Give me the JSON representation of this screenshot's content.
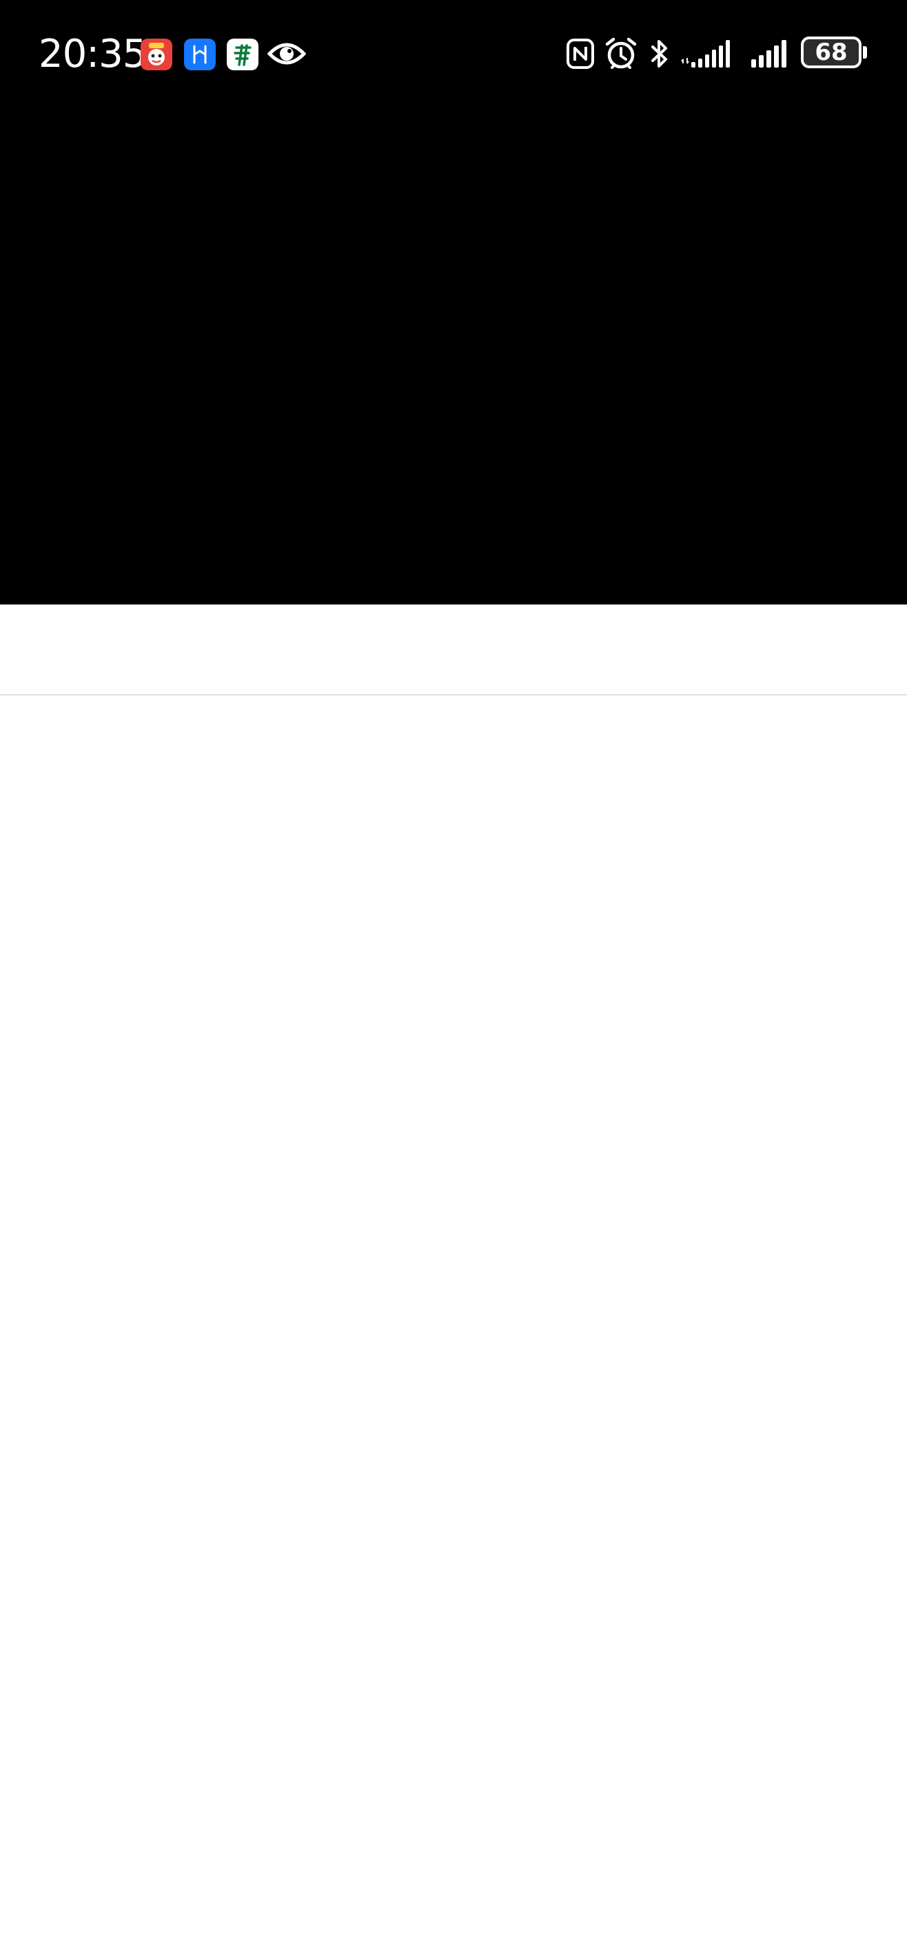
{
  "status_bar": {
    "time": "20:35",
    "battery_level": "68",
    "notification_icons": [
      "shopping-app-icon",
      "blue-h-app-icon",
      "post-bank-app-icon",
      "eye-icon"
    ],
    "system_icons": [
      "nfc-icon",
      "alarm-icon",
      "bluetooth-icon",
      "cellular-signal-1-icon",
      "cellular-signal-2-icon",
      "battery-icon"
    ]
  },
  "colors": {
    "status_background": "#000000",
    "page_background": "#ffffff",
    "divider": "#dedede"
  }
}
